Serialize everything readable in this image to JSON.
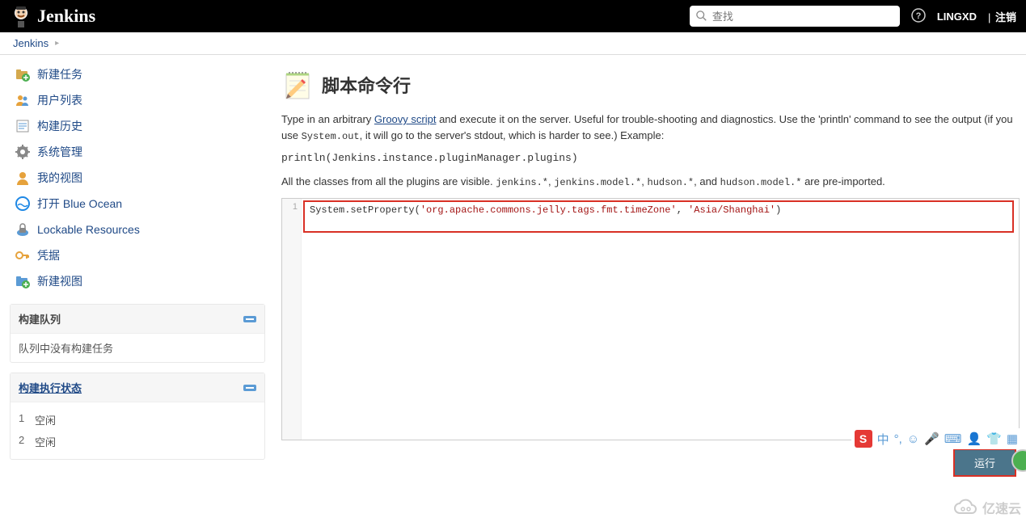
{
  "header": {
    "brand": "Jenkins",
    "search_placeholder": "查找",
    "user": "LINGXD",
    "logout": "注销"
  },
  "breadcrumb": {
    "root": "Jenkins"
  },
  "sidebar": {
    "items": [
      {
        "key": "new-item",
        "label": "新建任务"
      },
      {
        "key": "people",
        "label": "用户列表"
      },
      {
        "key": "build-history",
        "label": "构建历史"
      },
      {
        "key": "manage",
        "label": "系统管理"
      },
      {
        "key": "my-views",
        "label": "我的视图"
      },
      {
        "key": "blue-ocean",
        "label": "打开 Blue Ocean"
      },
      {
        "key": "lockable",
        "label": "Lockable Resources"
      },
      {
        "key": "credentials",
        "label": "凭据"
      },
      {
        "key": "new-view",
        "label": "新建视图"
      }
    ],
    "build_queue": {
      "title": "构建队列",
      "empty": "队列中没有构建任务"
    },
    "executor": {
      "title": "构建执行状态",
      "rows": [
        {
          "num": "1",
          "state": "空闲"
        },
        {
          "num": "2",
          "state": "空闲"
        }
      ]
    }
  },
  "page": {
    "title": "脚本命令行",
    "desc_pre": "Type in an arbitrary ",
    "groovy_link": "Groovy script",
    "desc_mid": " and execute it on the server. Useful for trouble-shooting and diagnostics. Use the 'println' command to see the output (if you use ",
    "desc_code1": "System.out",
    "desc_post": ", it will go to the server's stdout, which is harder to see.) Example:",
    "example_code": "println(Jenkins.instance.pluginManager.plugins)",
    "classes_pre": "All the classes from all the plugins are visible. ",
    "pkg1": "jenkins.*",
    "sep": ", ",
    "pkg2": "jenkins.model.*",
    "pkg3": "hudson.*",
    "and": ", and ",
    "pkg4": "hudson.model.*",
    "classes_post": " are pre-imported.",
    "editor": {
      "line_number": "1",
      "code_prefix": "System.setProperty(",
      "arg1": "'org.apache.commons.jelly.tags.fmt.timeZone'",
      "comma": ", ",
      "arg2": "'Asia/Shanghai'",
      "code_suffix": ")"
    },
    "run_button": "运行"
  },
  "ime": {
    "logo": "S",
    "mode": "中"
  },
  "watermark": "亿速云"
}
